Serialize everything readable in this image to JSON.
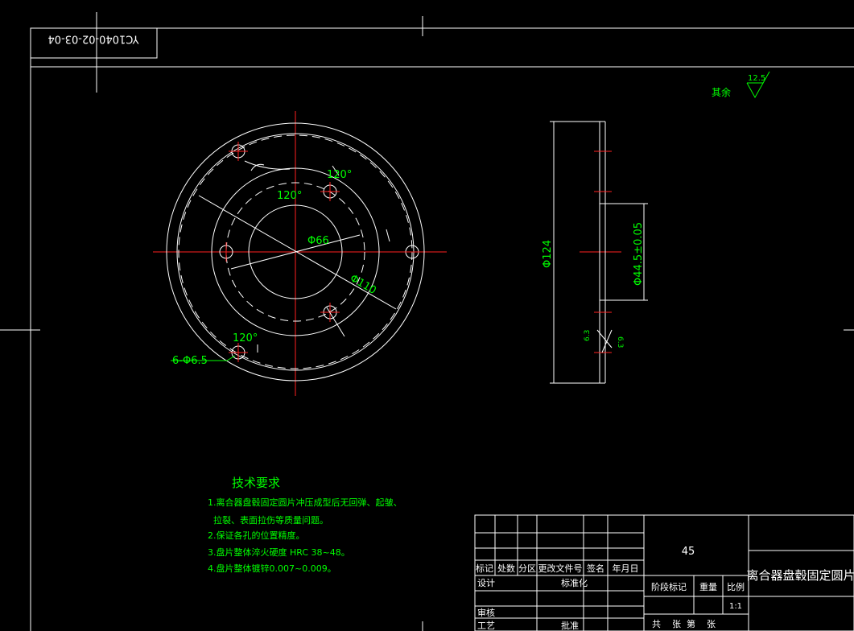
{
  "drawing_number": "YC1040-02-03-04",
  "roughness": {
    "label": "其余",
    "value": "12.5",
    "side_value_left": "6.3",
    "side_value_right": "6.3"
  },
  "dimensions": {
    "angle_top": "120°",
    "angle_mid": "120°",
    "angle_bottom": "120°",
    "d66": "Φ66",
    "d110": "Φ110",
    "holes": "6-Φ6.5",
    "d124": "Φ124",
    "d44": "Φ44.5±0.05"
  },
  "tech": {
    "title": "技术要求",
    "lines": [
      "1.离合器盘毂固定圆片冲压成型后无回弹、起皱、",
      "  拉裂、表面拉伤等质量问题。",
      "2.保证各孔的位置精度。",
      "3.盘片整体淬火硬度 HRC 38~48。",
      "4.盘片整体镀锌0.007~0.009。"
    ]
  },
  "title_block": {
    "material": "45",
    "part_name": "离合器盘毂固定圆片",
    "headers": [
      "标记",
      "处数",
      "分区",
      "更改文件号",
      "签名",
      "年月日"
    ],
    "design": "设计",
    "standardize": "标准化",
    "review": "审核",
    "process": "工艺",
    "approve": "批准",
    "stage_mark": "阶段标记",
    "weight": "重量",
    "scale": "比例",
    "scale_value": "1:1",
    "sheets": "共    张  第    张"
  }
}
